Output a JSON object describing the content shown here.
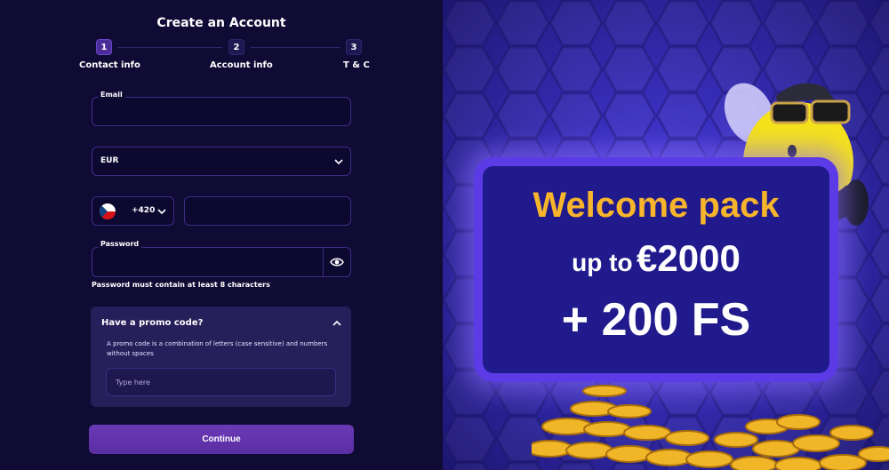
{
  "form": {
    "title": "Create an Account",
    "steps": [
      {
        "number": "1",
        "label": "Contact info"
      },
      {
        "number": "2",
        "label": "Account info"
      },
      {
        "number": "3",
        "label": "T & C"
      }
    ],
    "email_label": "Email",
    "currency_value": "EUR",
    "phone_code": "+420",
    "password_label": "Password",
    "password_hint": "Password must contain at least 8 characters",
    "promo": {
      "title": "Have a promo code?",
      "description": "A promo code is a combination of letters (case sensitive) and numbers without spaces",
      "placeholder": "Type here"
    },
    "continue_label": "Continue"
  },
  "banner": {
    "headline": "Welcome pack",
    "line2_prefix": "up to",
    "line2_amount": "€2000",
    "line3": "+ 200 FS"
  },
  "colors": {
    "accent": "#6a3ab6",
    "headline": "#f7b52c",
    "board_bg": "#211a8c"
  }
}
